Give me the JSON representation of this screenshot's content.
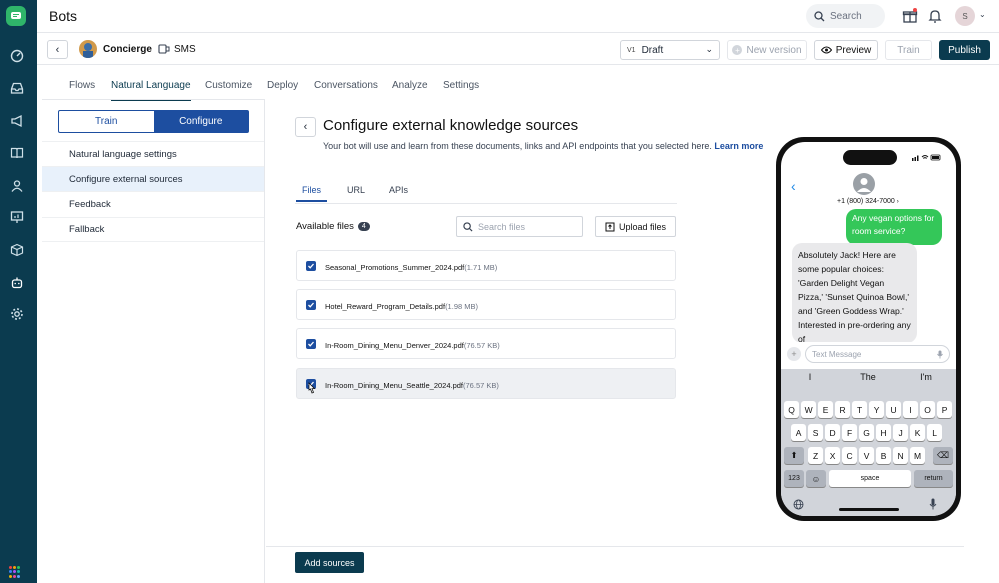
{
  "app": {
    "title": "Bots"
  },
  "header": {
    "search_placeholder": "Search",
    "avatar_initial": "S"
  },
  "bot": {
    "name": "Concierge",
    "channel": "SMS",
    "version_tag": "V1",
    "version_value": "Draft",
    "new_version_label": "New version",
    "preview_label": "Preview",
    "train_label": "Train",
    "publish_label": "Publish"
  },
  "tabs": [
    "Flows",
    "Natural Language",
    "Customize",
    "Deploy",
    "Conversations",
    "Analyze",
    "Settings"
  ],
  "sidebar": {
    "toggle": {
      "train": "Train",
      "configure": "Configure"
    },
    "items": [
      "Natural language settings",
      "Configure external sources",
      "Feedback",
      "Fallback"
    ]
  },
  "main": {
    "title": "Configure external knowledge sources",
    "subtitle": "Your bot will use and learn from these documents, links and API endpoints that you selected here.",
    "learn_more": "Learn more",
    "file_tabs": [
      "Files",
      "URL",
      "APIs"
    ],
    "available_label": "Available files",
    "available_count": "4",
    "search_placeholder": "Search files",
    "upload_label": "Upload files",
    "add_sources": "Add sources",
    "files": [
      {
        "name": "Seasonal_Promotions_Summer_2024.pdf",
        "size": "(1.71 MB)"
      },
      {
        "name": "Hotel_Reward_Program_Details.pdf",
        "size": "(1.98 MB)"
      },
      {
        "name": "In-Room_Dining_Menu_Denver_2024.pdf",
        "size": "(76.57 KB)"
      },
      {
        "name": "In-Room_Dining_Menu_Seattle_2024.pdf",
        "size": "(76.57 KB)"
      }
    ]
  },
  "phone": {
    "number": "+1 (800) 324-7000",
    "outgoing": "Any vegan options for room service?",
    "incoming": "Absolutely Jack! Here are some popular choices: 'Garden Delight Vegan Pizza,' 'Sunset Quinoa Bowl,' and 'Green Goddess Wrap.' Interested in pre-ordering any of",
    "input_placeholder": "Text Message",
    "suggestions": [
      "I",
      "The",
      "I'm"
    ],
    "row1": [
      "Q",
      "W",
      "E",
      "R",
      "T",
      "Y",
      "U",
      "I",
      "O",
      "P"
    ],
    "row2": [
      "A",
      "S",
      "D",
      "F",
      "G",
      "H",
      "J",
      "K",
      "L"
    ],
    "row3": [
      "Z",
      "X",
      "C",
      "V",
      "B",
      "N",
      "M"
    ],
    "num_key": "123",
    "space_key": "space",
    "return_key": "return"
  },
  "colors": {
    "rail": "#0b3b4f",
    "primary": "#1d4ea0",
    "brand": "#2fb56a"
  }
}
